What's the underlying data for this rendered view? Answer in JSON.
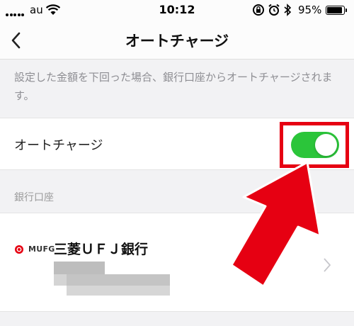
{
  "status_bar": {
    "carrier": "au",
    "time": "10:12",
    "battery_percent": "95%",
    "battery_level": 0.95
  },
  "nav": {
    "title": "オートチャージ"
  },
  "description": "設定した金額を下回った場合、銀行口座からオートチャージされます。",
  "auto_charge": {
    "label": "オートチャージ",
    "enabled": true,
    "toggle_color": "#2bc53a"
  },
  "bank_section": {
    "header": "銀行口座",
    "bank": {
      "logo_text": "MUFG",
      "name": "三菱ＵＦＪ銀行"
    }
  },
  "annotation": {
    "highlight_color": "#e60012"
  }
}
